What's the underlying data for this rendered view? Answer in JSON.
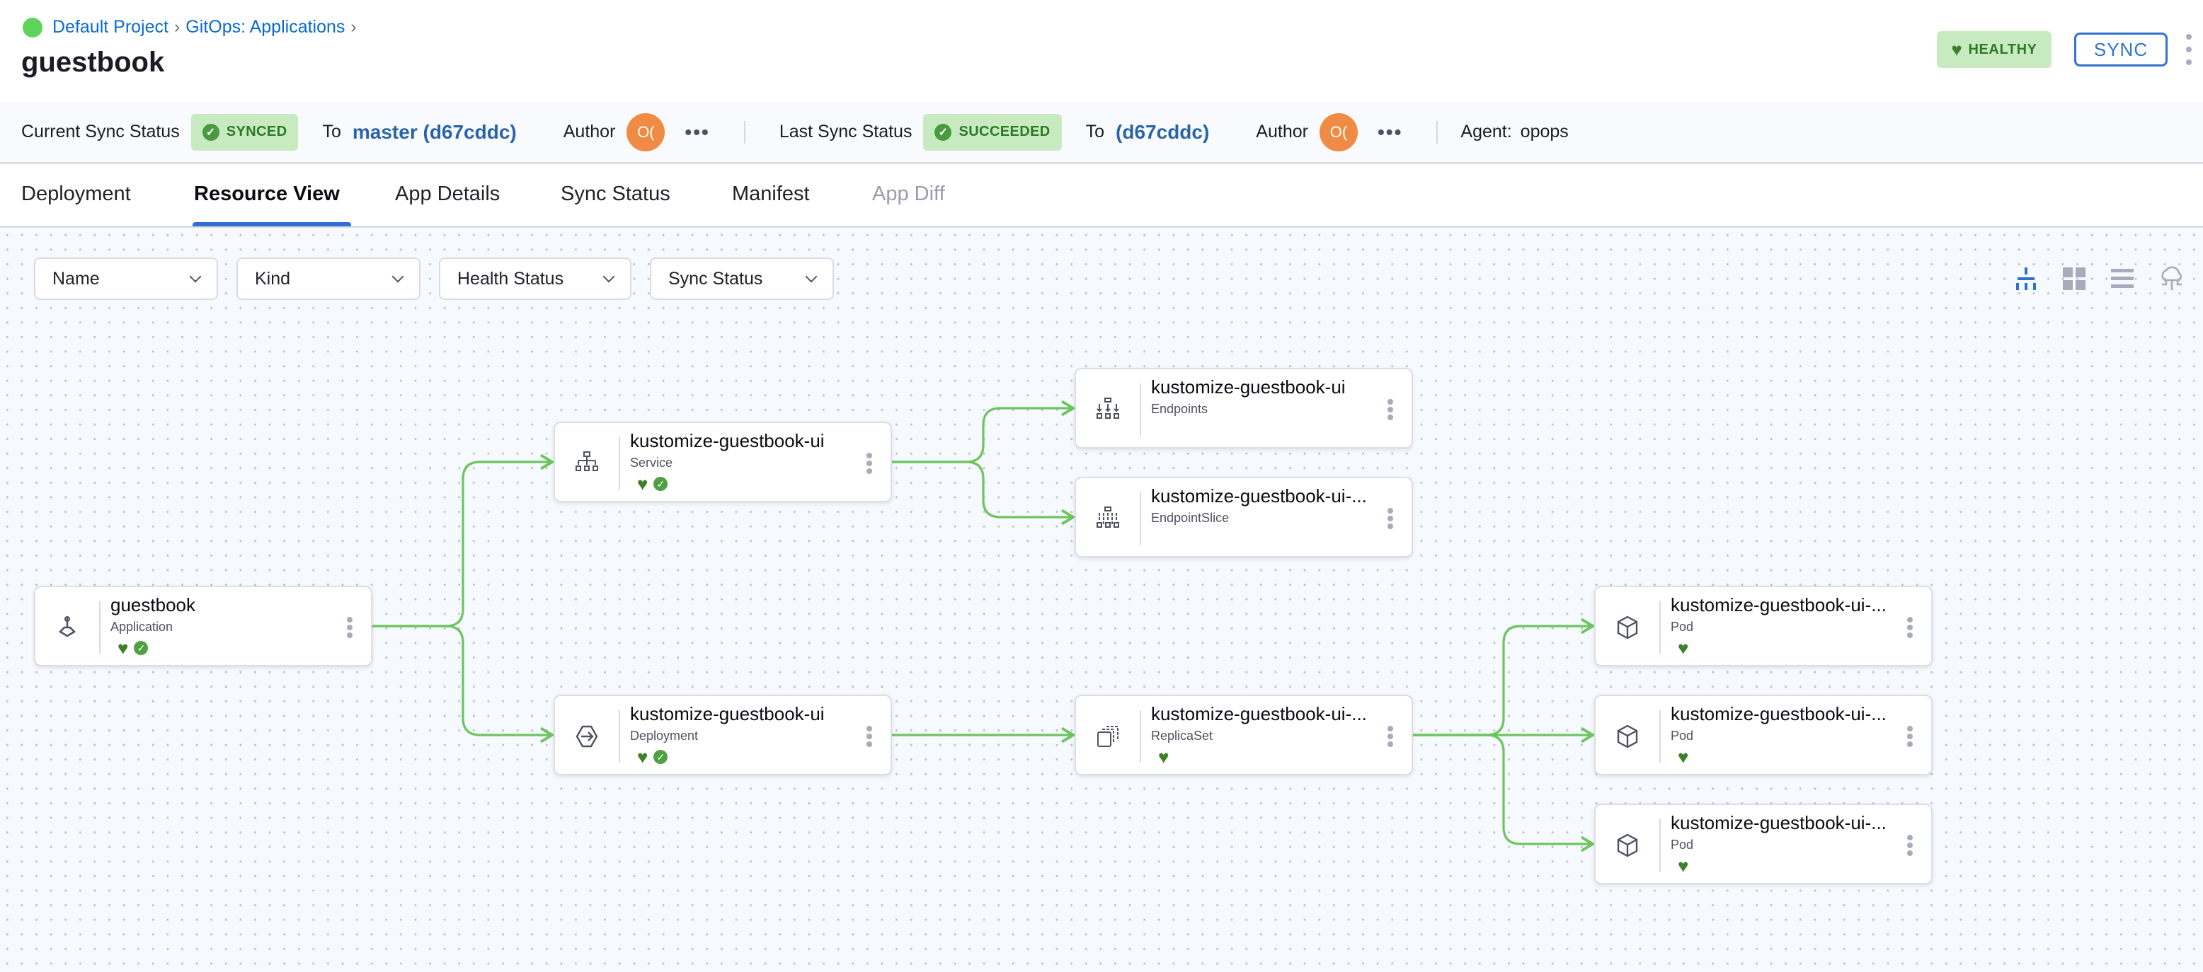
{
  "breadcrumb": [
    "Default Project",
    "GitOps: Applications"
  ],
  "title": "guestbook",
  "health_badge": "HEALTHY",
  "sync_button": "SYNC",
  "status_bar": {
    "current_label": "Current Sync Status",
    "current_status": "SYNCED",
    "current_to": "To",
    "current_revision": "master (d67cddc)",
    "current_author_label": "Author",
    "current_author": "O(",
    "last_label": "Last Sync Status",
    "last_status": "SUCCEEDED",
    "last_to": "To",
    "last_revision": "(d67cddc)",
    "last_author_label": "Author",
    "last_author": "O(",
    "agent_label": "Agent:",
    "agent": "opops",
    "more": "•••"
  },
  "tabs": [
    {
      "label": "Deployment"
    },
    {
      "label": "Resource View",
      "active": true
    },
    {
      "label": "App Details"
    },
    {
      "label": "Sync Status"
    },
    {
      "label": "Manifest"
    },
    {
      "label": "App Diff",
      "disabled": true
    }
  ],
  "filters": [
    "Name",
    "Kind",
    "Health Status",
    "Sync Status"
  ],
  "view_modes": [
    {
      "icon": "tree-icon",
      "active": true
    },
    {
      "icon": "grid-icon"
    },
    {
      "icon": "list-icon"
    },
    {
      "icon": "network-cloud-icon"
    }
  ],
  "colors": {
    "accent": "#2f6fce",
    "healthy": "#3f7f2c",
    "edge": "#6cc55e",
    "avatar": "#ef8b45"
  },
  "nodes": [
    {
      "id": "app",
      "name": "guestbook",
      "kind": "Application",
      "icon": "application-icon",
      "healthy": true,
      "synced": true
    },
    {
      "id": "svc",
      "name": "kustomize-guestbook-ui",
      "kind": "Service",
      "icon": "service-icon",
      "healthy": true,
      "synced": true
    },
    {
      "id": "dep",
      "name": "kustomize-guestbook-ui",
      "kind": "Deployment",
      "icon": "deployment-icon",
      "healthy": true,
      "synced": true
    },
    {
      "id": "ep",
      "name": "kustomize-guestbook-ui",
      "kind": "Endpoints",
      "icon": "endpoints-icon",
      "healthy": false,
      "synced": false
    },
    {
      "id": "eps",
      "name": "kustomize-guestbook-ui-...",
      "kind": "EndpointSlice",
      "icon": "endpointslice-icon",
      "healthy": false,
      "synced": false
    },
    {
      "id": "rs",
      "name": "kustomize-guestbook-ui-...",
      "kind": "ReplicaSet",
      "icon": "replicaset-icon",
      "healthy": true,
      "synced": false
    },
    {
      "id": "pod1",
      "name": "kustomize-guestbook-ui-...",
      "kind": "Pod",
      "icon": "pod-icon",
      "healthy": true,
      "synced": false
    },
    {
      "id": "pod2",
      "name": "kustomize-guestbook-ui-...",
      "kind": "Pod",
      "icon": "pod-icon",
      "healthy": true,
      "synced": false
    },
    {
      "id": "pod3",
      "name": "kustomize-guestbook-ui-...",
      "kind": "Pod",
      "icon": "pod-icon",
      "healthy": true,
      "synced": false
    }
  ],
  "edges": [
    [
      "app",
      "svc"
    ],
    [
      "app",
      "dep"
    ],
    [
      "svc",
      "ep"
    ],
    [
      "svc",
      "eps"
    ],
    [
      "dep",
      "rs"
    ],
    [
      "rs",
      "pod1"
    ],
    [
      "rs",
      "pod2"
    ],
    [
      "rs",
      "pod3"
    ]
  ]
}
